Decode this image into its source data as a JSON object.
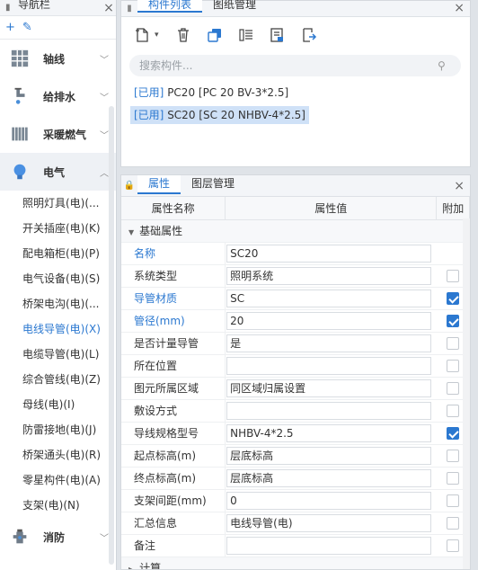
{
  "nav": {
    "title": "导航栏",
    "close": "×",
    "categories_top": [
      {
        "label": "轴线",
        "icon": "grid-icon"
      },
      {
        "label": "给排水",
        "icon": "faucet-icon"
      },
      {
        "label": "采暖燃气",
        "icon": "radiator-icon"
      }
    ],
    "active_category": {
      "label": "电气",
      "icon": "bulb-icon"
    },
    "sub_items": [
      "照明灯具(电)(...",
      "开关插座(电)(K)",
      "配电箱柜(电)(P)",
      "电气设备(电)(S)",
      "桥架电沟(电)(...",
      "电线导管(电)(X)",
      "电缆导管(电)(L)",
      "综合管线(电)(Z)",
      "母线(电)(I)",
      "防雷接地(电)(J)",
      "桥架通头(电)(R)",
      "零星构件(电)(A)",
      "支架(电)(N)"
    ],
    "selected_sub_index": 5,
    "categories_bottom": [
      {
        "label": "消防",
        "icon": "hydrant-icon"
      }
    ]
  },
  "list_panel": {
    "tabs": [
      "构件列表",
      "图纸管理"
    ],
    "active_tab": 0,
    "search_placeholder": "搜索构件...",
    "items": [
      {
        "tag": "[已用]",
        "text": " PC20 [PC 20 BV-3*2.5]",
        "selected": false
      },
      {
        "tag": "[已用]",
        "text": " SC20 [SC 20 NHBV-4*2.5]",
        "selected": true
      }
    ]
  },
  "prop_panel": {
    "tabs": [
      "属性",
      "图层管理"
    ],
    "active_tab": 0,
    "headers": [
      "属性名称",
      "属性值",
      "附加"
    ],
    "group_label": "基础属性",
    "rows": [
      {
        "name": "名称",
        "value": "SC20",
        "blue": true,
        "check": null
      },
      {
        "name": "系统类型",
        "value": "照明系统",
        "blue": false,
        "check": false
      },
      {
        "name": "导管材质",
        "value": "SC",
        "blue": true,
        "check": true
      },
      {
        "name": "管径(mm)",
        "value": "20",
        "blue": true,
        "check": true
      },
      {
        "name": "是否计量导管",
        "value": "是",
        "blue": false,
        "check": false
      },
      {
        "name": "所在位置",
        "value": "",
        "blue": false,
        "check": false
      },
      {
        "name": "图元所属区域",
        "value": "同区域归属设置",
        "blue": false,
        "check": false
      },
      {
        "name": "敷设方式",
        "value": "",
        "blue": false,
        "check": false
      },
      {
        "name": "导线规格型号",
        "value": "NHBV-4*2.5",
        "blue": false,
        "check": true
      },
      {
        "name": "起点标高(m)",
        "value": "层底标高",
        "blue": false,
        "check": false
      },
      {
        "name": "终点标高(m)",
        "value": "层底标高",
        "blue": false,
        "check": false
      },
      {
        "name": "支架间距(mm)",
        "value": "0",
        "blue": false,
        "check": false
      },
      {
        "name": "汇总信息",
        "value": "电线导管(电)",
        "blue": false,
        "check": false
      },
      {
        "name": "备注",
        "value": "",
        "blue": false,
        "check": false
      }
    ],
    "next_group_label": "计算"
  }
}
